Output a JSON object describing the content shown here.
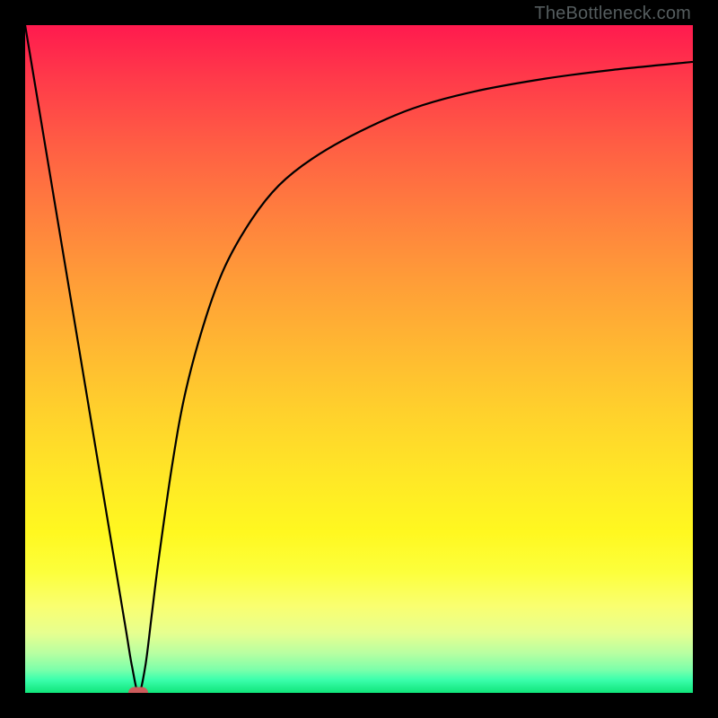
{
  "watermark": "TheBottleneck.com",
  "colors": {
    "frame": "#000000",
    "curve": "#000000",
    "marker": "#cd5c5c",
    "gradient_top": "#ff1a4e",
    "gradient_bottom": "#10e57a"
  },
  "chart_data": {
    "type": "line",
    "title": "",
    "xlabel": "",
    "ylabel": "",
    "xlim": [
      0,
      100
    ],
    "ylim": [
      0,
      100
    ],
    "axes_hidden": true,
    "background": "rainbow-gradient-vertical",
    "series": [
      {
        "name": "bottleneck-curve",
        "x": [
          0,
          3,
          6,
          9,
          12,
          15,
          16,
          17,
          18,
          19,
          20,
          22,
          24,
          27,
          30,
          34,
          38,
          43,
          50,
          58,
          67,
          78,
          88,
          100
        ],
        "y": [
          100,
          82,
          64,
          46,
          28,
          10,
          4,
          0,
          4,
          12,
          20,
          34,
          45,
          56,
          64,
          71,
          76,
          80,
          84,
          87.5,
          90,
          92,
          93.3,
          94.5
        ]
      }
    ],
    "marker": {
      "x": 17,
      "y": 0,
      "shape": "rounded-rect",
      "color": "#cd5c5c"
    }
  }
}
